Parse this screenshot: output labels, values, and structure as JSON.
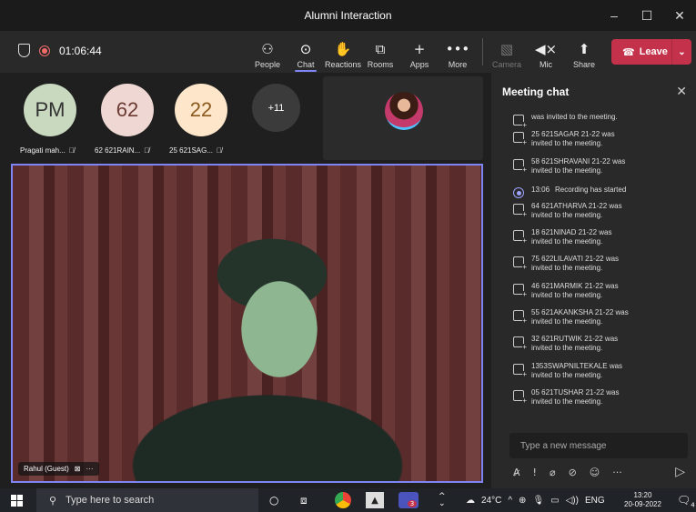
{
  "window": {
    "title": "Alumni Interaction",
    "controls": [
      "–",
      "☐",
      "✕"
    ]
  },
  "toolbar": {
    "timer": "01:06:44",
    "buttons": [
      {
        "label": "People",
        "icon": "people-icon",
        "glyph": "⚇"
      },
      {
        "label": "Chat",
        "icon": "chat-icon",
        "glyph": "⊙"
      },
      {
        "label": "Reactions",
        "icon": "reactions-icon",
        "glyph": "✋"
      },
      {
        "label": "Rooms",
        "icon": "rooms-icon",
        "glyph": "⧉"
      },
      {
        "label": "Apps",
        "icon": "apps-icon",
        "glyph": "+"
      },
      {
        "label": "More",
        "icon": "more-icon",
        "glyph": "•••"
      },
      {
        "label": "Camera",
        "icon": "camera-off-icon",
        "glyph": "▧"
      },
      {
        "label": "Mic",
        "icon": "mic-muted-icon",
        "glyph": "◀×"
      },
      {
        "label": "Share",
        "icon": "share-icon",
        "glyph": "⬆"
      }
    ],
    "leave_label": "Leave",
    "leave_color": "#c4314b",
    "accent_color": "#7f85f5"
  },
  "participants": [
    {
      "initials": "PM",
      "name": "Pragati mah...",
      "bg": "#c9d9c0",
      "fg": "#333333"
    },
    {
      "initials": "62",
      "name": "62 621RAIN...",
      "bg": "#efd8d3",
      "fg": "#6b3b33"
    },
    {
      "initials": "22",
      "name": "25 621SAG...",
      "bg": "#fde6c9",
      "fg": "#8a5a1e"
    }
  ],
  "more_count": "+11",
  "main_video": {
    "name": "Rahul (Guest)"
  },
  "chat": {
    "title": "Meeting chat",
    "messages": [
      {
        "text": "was invited to the meeting.",
        "type": "invite",
        "partial": true
      },
      {
        "line1": "25 621SAGAR 21-22 was",
        "line2": "invited to the meeting.",
        "type": "invite"
      },
      {
        "line1": "58 621SHRAVANI 21-22 was",
        "line2": "invited to the meeting.",
        "type": "invite"
      },
      {
        "time": "13:06",
        "line1": "Recording has started",
        "type": "recording"
      },
      {
        "line1": "64 621ATHARVA 21-22 was",
        "line2": "invited to the meeting.",
        "type": "invite"
      },
      {
        "line1": "18 621NINAD 21-22 was",
        "line2": "invited to the meeting.",
        "type": "invite"
      },
      {
        "line1": "75 622LILAVATI 21-22 was",
        "line2": "invited to the meeting.",
        "type": "invite"
      },
      {
        "line1": "46 621MARMIK 21-22 was",
        "line2": "invited to the meeting.",
        "type": "invite"
      },
      {
        "line1": "55 621AKANKSHA 21-22 was",
        "line2": "invited to the meeting.",
        "type": "invite"
      },
      {
        "line1": "32 621RUTWIK 21-22 was",
        "line2": "invited to the meeting.",
        "type": "invite"
      },
      {
        "line1": "1353SWAPNILTEKALE was",
        "line2": "invited to the meeting.",
        "type": "invite"
      },
      {
        "line1": "05 621TUSHAR 21-22 was",
        "line2": "invited to the meeting.",
        "type": "invite"
      }
    ],
    "compose_placeholder": "Type a new message"
  },
  "taskbar": {
    "search_placeholder": "Type here to search",
    "badge": "3",
    "weather": "24°C",
    "language": "ENG",
    "time": "13:20",
    "date": "20-09-2022",
    "notifications": "4"
  }
}
